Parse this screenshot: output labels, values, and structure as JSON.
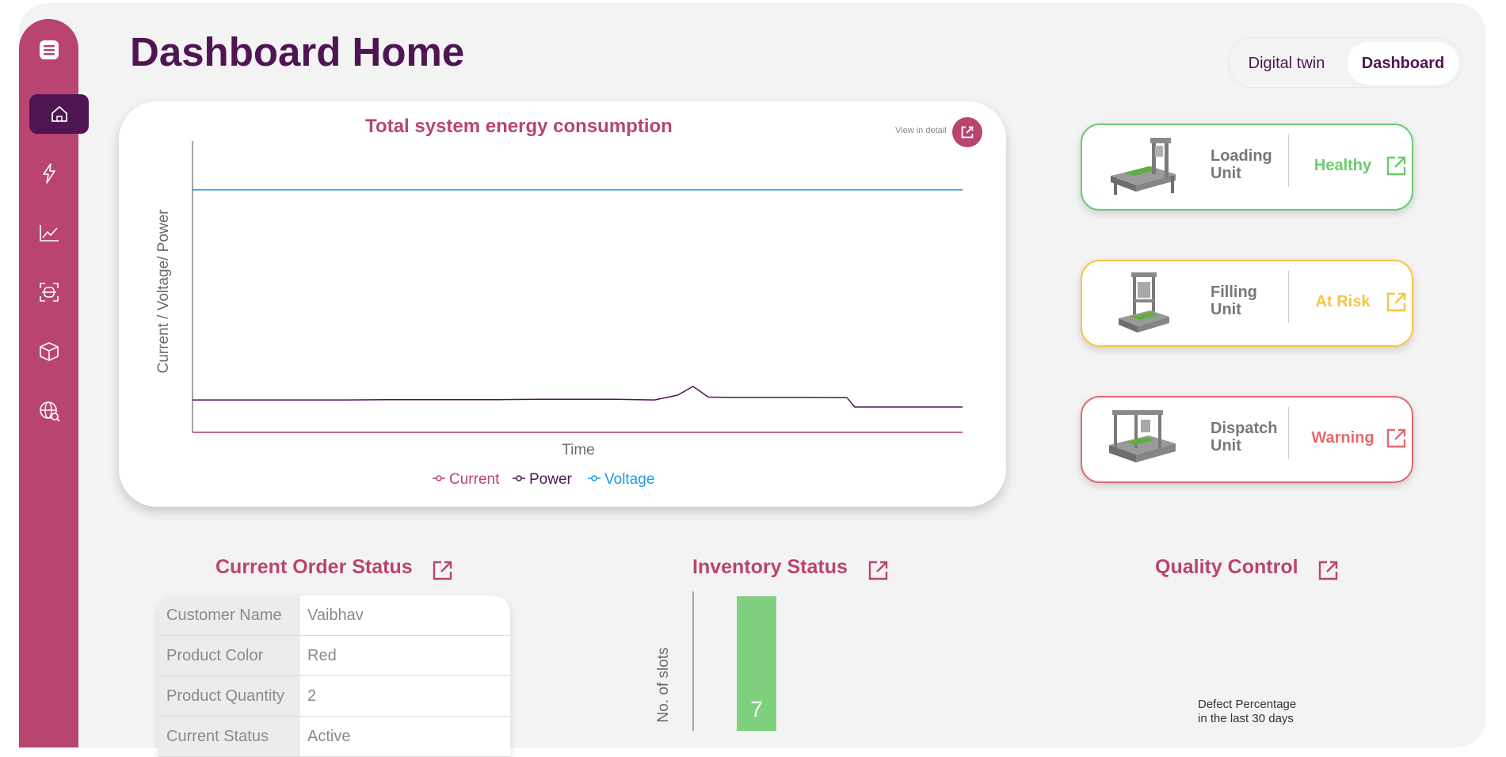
{
  "page": {
    "title": "Dashboard Home"
  },
  "view_toggle": {
    "options": [
      "Digital twin",
      "Dashboard"
    ],
    "active": "Dashboard"
  },
  "sidebar": {
    "items": [
      {
        "name": "menu",
        "icon": "menu-icon"
      },
      {
        "name": "home",
        "icon": "home-icon",
        "active": true
      },
      {
        "name": "energy",
        "icon": "lightning-icon"
      },
      {
        "name": "analytics",
        "icon": "line-chart-icon"
      },
      {
        "name": "scan",
        "icon": "scan-icon"
      },
      {
        "name": "inventory",
        "icon": "box-icon"
      },
      {
        "name": "global-search",
        "icon": "globe-search-icon"
      }
    ]
  },
  "energy_card": {
    "view_detail_label": "View in detail",
    "chart_data": {
      "type": "line",
      "title": "Total system energy consumption",
      "xlabel": "Time",
      "ylabel": "Current / Voltage/ Power",
      "x": [
        0,
        5,
        10,
        15,
        20,
        25,
        30,
        35,
        40,
        45,
        50,
        55,
        60,
        63,
        65,
        67,
        70,
        75,
        80,
        85,
        86,
        90,
        95,
        100
      ],
      "series": [
        {
          "name": "Current",
          "color": "#b94470",
          "values": [
            0,
            0,
            0,
            0,
            0,
            0,
            0,
            0,
            0,
            0,
            0,
            0,
            0,
            0,
            0,
            0,
            0,
            0,
            0,
            0,
            0,
            0,
            0,
            0
          ]
        },
        {
          "name": "Power",
          "color": "#4f1553",
          "values": [
            11.5,
            11.5,
            11.5,
            11.5,
            11.5,
            11.6,
            11.6,
            11.6,
            11.6,
            11.7,
            11.7,
            11.7,
            11.5,
            13.2,
            16.3,
            12.5,
            12.4,
            12.4,
            12.4,
            12.3,
            9.0,
            9.0,
            9.0,
            9.0
          ]
        },
        {
          "name": "Voltage",
          "color": "#1e9be0",
          "values": [
            86,
            86,
            86,
            86,
            86,
            86,
            86,
            86,
            86,
            86,
            86,
            86,
            86,
            86,
            86,
            86,
            86,
            86,
            86,
            86,
            86,
            86,
            86,
            86
          ]
        }
      ],
      "ylim": [
        0,
        100
      ],
      "grid": false,
      "legend_position": "bottom"
    }
  },
  "units": [
    {
      "name": "Loading Unit",
      "status": "Healthy",
      "color": "#6ccb6c",
      "icon": "loading-unit-machine-icon"
    },
    {
      "name": "Filling Unit",
      "status": "At Risk",
      "color": "#f6c544",
      "icon": "filling-unit-machine-icon"
    },
    {
      "name": "Dispatch Unit",
      "status": "Warning",
      "color": "#e5696b",
      "icon": "dispatch-unit-machine-icon"
    }
  ],
  "order_status": {
    "title": "Current Order Status",
    "rows": [
      {
        "label": "Customer Name",
        "value": "Vaibhav"
      },
      {
        "label": "Product Color",
        "value": "Red"
      },
      {
        "label": "Product Quantity",
        "value": "2"
      },
      {
        "label": "Current Status",
        "value": "Active"
      }
    ]
  },
  "inventory": {
    "title": "Inventory Status",
    "chart_data": {
      "type": "bar",
      "ylabel": "No. of slots",
      "categories": [
        ""
      ],
      "values": [
        7
      ],
      "bar_color": "#7ed07e"
    }
  },
  "quality": {
    "title": "Quality Control",
    "note_line1": "Defect Percentage",
    "note_line2": "in the last 30 days"
  }
}
